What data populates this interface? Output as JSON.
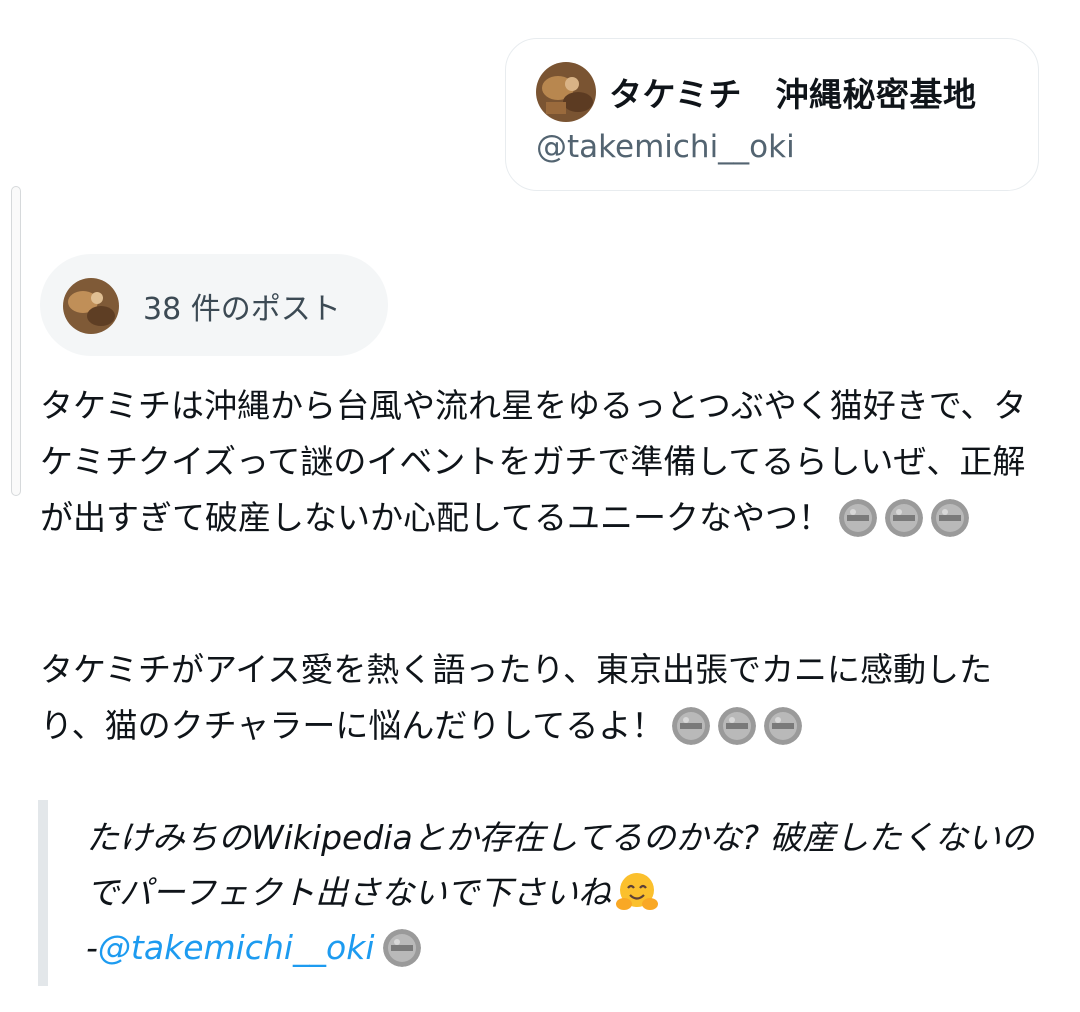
{
  "user_card": {
    "display_name": "タケミチ　沖縄秘密基地",
    "handle": "@takemichi__oki"
  },
  "post_summary": {
    "count_label": "38 件のポスト"
  },
  "summary": {
    "paragraph_1": "タケミチは沖縄から台風や流れ星をゆるっとつぶやく猫好きで、タケミチクイズって謎のイベントをガチで準備してるらしいぜ、正解が出すぎて破産しないか心配してるユニークなやつ！",
    "paragraph_2": "タケミチがアイス愛を熱く語ったり、東京出張でカニに感動したり、猫のクチャラーに悩んだりしてるよ！"
  },
  "quote": {
    "text": "たけみちのWikipediaとか存在してるのかな? 破産したくないのでパーフェクト出さないで下さいね",
    "dash": "-",
    "author": "@takemichi__oki"
  },
  "icons": {
    "avatar": "user-avatar-photo",
    "post_face": "post-thumbnail-icon",
    "hug_emoji": "hugging-face-emoji"
  },
  "colors": {
    "link": "#1d9bf0",
    "secondary_text": "#536471",
    "pill_bg": "#f4f6f7",
    "quote_bar": "#e3e7ea"
  }
}
